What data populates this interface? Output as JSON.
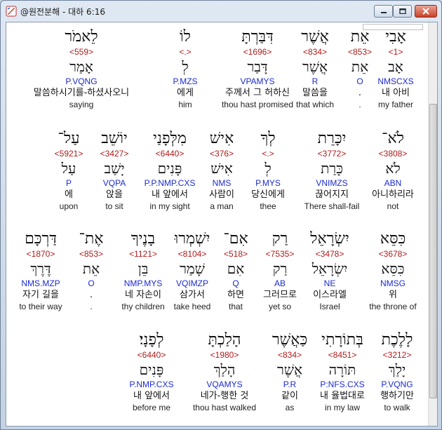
{
  "window": {
    "title": "@원전분해 - 대하 6:16"
  },
  "rows": [
    [
      {
        "heb": "אָבִי",
        "num": "<1>",
        "lemma": "אָב",
        "parse": "NMSCXS",
        "ko": "내 아비",
        "en": "my father"
      },
      {
        "heb": "אֵת",
        "num": "<853>",
        "lemma": "אֵת",
        "parse": "O",
        "ko": ".",
        "en": "."
      },
      {
        "heb": "אֲשֶׁר",
        "num": "<834>",
        "lemma": "אֲשֶׁר",
        "parse": "R",
        "ko": "말씀을",
        "en": "that which"
      },
      {
        "heb": "דִּבַּרְתָּ",
        "num": "<1696>",
        "lemma": "דָּבַר",
        "parse": "VPAMYS",
        "ko": "주께서 그 허하신",
        "en": "thou hast promised"
      },
      {
        "heb": "לוֹ",
        "num": "<.>",
        "lemma": "לְ",
        "parse": "P.MZS",
        "ko": "에게",
        "en": "him"
      },
      {
        "heb": "לֵאמֹר",
        "num": "<559>",
        "lemma": "אָמַר",
        "parse": "P.VQNG",
        "ko": "말씀하시기를-하셨사오니",
        "en": "saying"
      }
    ],
    [
      {
        "heb": "לֹא־",
        "num": "<3808>",
        "lemma": "לֹא",
        "parse": "ABN",
        "ko": "아니하리라",
        "en": "not"
      },
      {
        "heb": "יִכָּרֵת",
        "num": "<3772>",
        "lemma": "כָּרַת",
        "parse": "VNIMZS",
        "ko": "끊어지지",
        "en": "There shall-fail"
      },
      {
        "heb": "לְךָ",
        "num": "<.>",
        "lemma": "לְ",
        "parse": "P.MYS",
        "ko": "당신에게",
        "en": "thee"
      },
      {
        "heb": "אִישׁ",
        "num": "<376>",
        "lemma": "אִישׁ",
        "parse": "NMS",
        "ko": "사람이",
        "en": "a man"
      },
      {
        "heb": "מִלְּפָנַי",
        "num": "<6440>",
        "lemma": "פָּנִים",
        "parse": "P.P.NMP.CXS",
        "ko": "내 앞에서",
        "en": "in my sight"
      },
      {
        "heb": "יוֹשֵׁב",
        "num": "<3427>",
        "lemma": "יָשַׁב",
        "parse": "VQPA",
        "ko": "앉을",
        "en": "to sit"
      },
      {
        "heb": "עַל־",
        "num": "<5921>",
        "lemma": "עַל",
        "parse": "P",
        "ko": "에",
        "en": "upon"
      }
    ],
    [
      {
        "heb": "כִּסֵּא",
        "num": "<3678>",
        "lemma": "כִּסֵּא",
        "parse": "NMSG",
        "ko": "위",
        "en": "the throne of"
      },
      {
        "heb": "יִשְׂרָאֵל",
        "num": "<3478>",
        "lemma": "יִשְׂרָאֵל",
        "parse": "NE",
        "ko": "이스라엘",
        "en": "Israel"
      },
      {
        "heb": "רַק",
        "num": "<7535>",
        "lemma": "רַק",
        "parse": "AB",
        "ko": "그러므로",
        "en": "yet so"
      },
      {
        "heb": "אִם־",
        "num": "<518>",
        "lemma": "אִם",
        "parse": "Q",
        "ko": "하면",
        "en": "that"
      },
      {
        "heb": "יִשְׁמְרוּ",
        "num": "<8104>",
        "lemma": "שָׁמַר",
        "parse": "VQIMZP",
        "ko": "삼가서",
        "en": "take heed"
      },
      {
        "heb": "בָנֶיךָ",
        "num": "<1121>",
        "lemma": "בֵּן",
        "parse": "NMP.MYS",
        "ko": "네 자손이",
        "en": "thy children"
      },
      {
        "heb": "אֶת־",
        "num": "<853>",
        "lemma": "אֵת",
        "parse": "O",
        "ko": ".",
        "en": "."
      },
      {
        "heb": "דַּרְכָּם",
        "num": "<1870>",
        "lemma": "דֶּרֶךְ",
        "parse": "NMS.MZP",
        "ko": "자기 길을",
        "en": "to their way"
      }
    ],
    [
      {
        "heb": "לָלֶכֶת",
        "num": "<3212>",
        "lemma": "יָלַךְ",
        "parse": "P.VQNG",
        "ko": "행하기만",
        "en": "to walk"
      },
      {
        "heb": "בְּתוֹרָתִי",
        "num": "<8451>",
        "lemma": "תּוֹרָה",
        "parse": "P:NFS.CXS",
        "ko": "내 율법대로",
        "en": "in my law"
      },
      {
        "heb": "כַּאֲשֶׁר",
        "num": "<834>",
        "lemma": "אֲשֶׁר",
        "parse": "P.R",
        "ko": "같이",
        "en": "as"
      },
      {
        "heb": "הָלַכְתָּ",
        "num": "<1980>",
        "lemma": "הָלַךְ",
        "parse": "VQAMYS",
        "ko": "네가-행한 것",
        "en": "thou hast walked"
      },
      {
        "heb": "לְפָנָי׃",
        "num": "<6440>",
        "lemma": "פָּנִים",
        "parse": "P.NMP.CXS",
        "ko": "내 앞에서",
        "en": "before me"
      }
    ]
  ]
}
